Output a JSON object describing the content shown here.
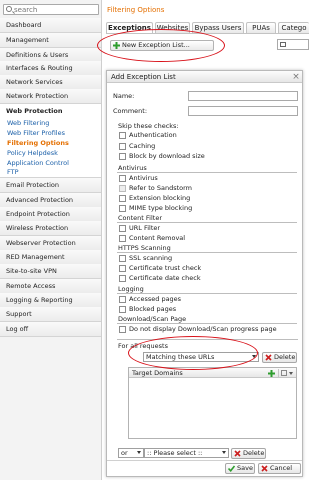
{
  "sidebar": {
    "search_placeholder": "search",
    "items": [
      {
        "label": "Dashboard"
      },
      {
        "label": "Management"
      },
      {
        "label": "Definitions & Users"
      },
      {
        "label": "Interfaces & Routing"
      },
      {
        "label": "Network Services"
      },
      {
        "label": "Network Protection"
      },
      {
        "label": "Web Protection"
      },
      {
        "label": "Email Protection"
      },
      {
        "label": "Advanced Protection"
      },
      {
        "label": "Endpoint Protection"
      },
      {
        "label": "Wireless Protection"
      },
      {
        "label": "Webserver Protection"
      },
      {
        "label": "RED Management"
      },
      {
        "label": "Site-to-site VPN"
      },
      {
        "label": "Remote Access"
      },
      {
        "label": "Logging & Reporting"
      },
      {
        "label": "Support"
      },
      {
        "label": "Log off"
      }
    ],
    "web_protection_sub": [
      {
        "label": "Web Filtering"
      },
      {
        "label": "Web Filter Profiles"
      },
      {
        "label": "Filtering Options"
      },
      {
        "label": "Policy Helpdesk"
      },
      {
        "label": "Application Control"
      },
      {
        "label": "FTP"
      }
    ]
  },
  "header": {
    "breadcrumb": "Filtering Options",
    "tabs": [
      {
        "label": "Exceptions"
      },
      {
        "label": "Websites"
      },
      {
        "label": "Bypass Users"
      },
      {
        "label": "PUAs"
      },
      {
        "label": "Catego"
      }
    ],
    "new_button": "New Exception List..."
  },
  "dialog": {
    "title": "Add Exception List",
    "close": "×",
    "name_label": "Name:",
    "comment_label": "Comment:",
    "skip_label": "Skip these checks:",
    "checks_general": [
      "Authentication",
      "Caching",
      "Block by download size"
    ],
    "antivirus_label": "Antivirus",
    "checks_antivirus": [
      "Antivirus",
      "Refer to Sandstorm",
      "Extension blocking",
      "MIME type blocking"
    ],
    "content_label": "Content Filter",
    "checks_content": [
      "URL Filter",
      "Content Removal"
    ],
    "https_label": "HTTPS Scanning",
    "checks_https": [
      "SSL scanning",
      "Certificate trust check",
      "Certificate date check"
    ],
    "logging_label": "Logging",
    "checks_logging": [
      "Accessed pages",
      "Blocked pages"
    ],
    "download_label": "Download/Scan Page",
    "checks_download": [
      "Do not display Download/Scan progress page"
    ],
    "for_all_requests": "For all requests",
    "matching_select": "Matching these URLs",
    "delete_label": "Delete",
    "target_domains": "Target Domains",
    "or_select": "or",
    "please_select": ":: Please select ::",
    "delete_label2": "Delete",
    "save_label": "Save",
    "cancel_label": "Cancel"
  },
  "colors": {
    "accent": "#e46f00",
    "link": "#1a5fa8",
    "annotation_red": "#d8121a",
    "add_green": "#2e9d2e",
    "delete_red": "#cc1f1f"
  }
}
